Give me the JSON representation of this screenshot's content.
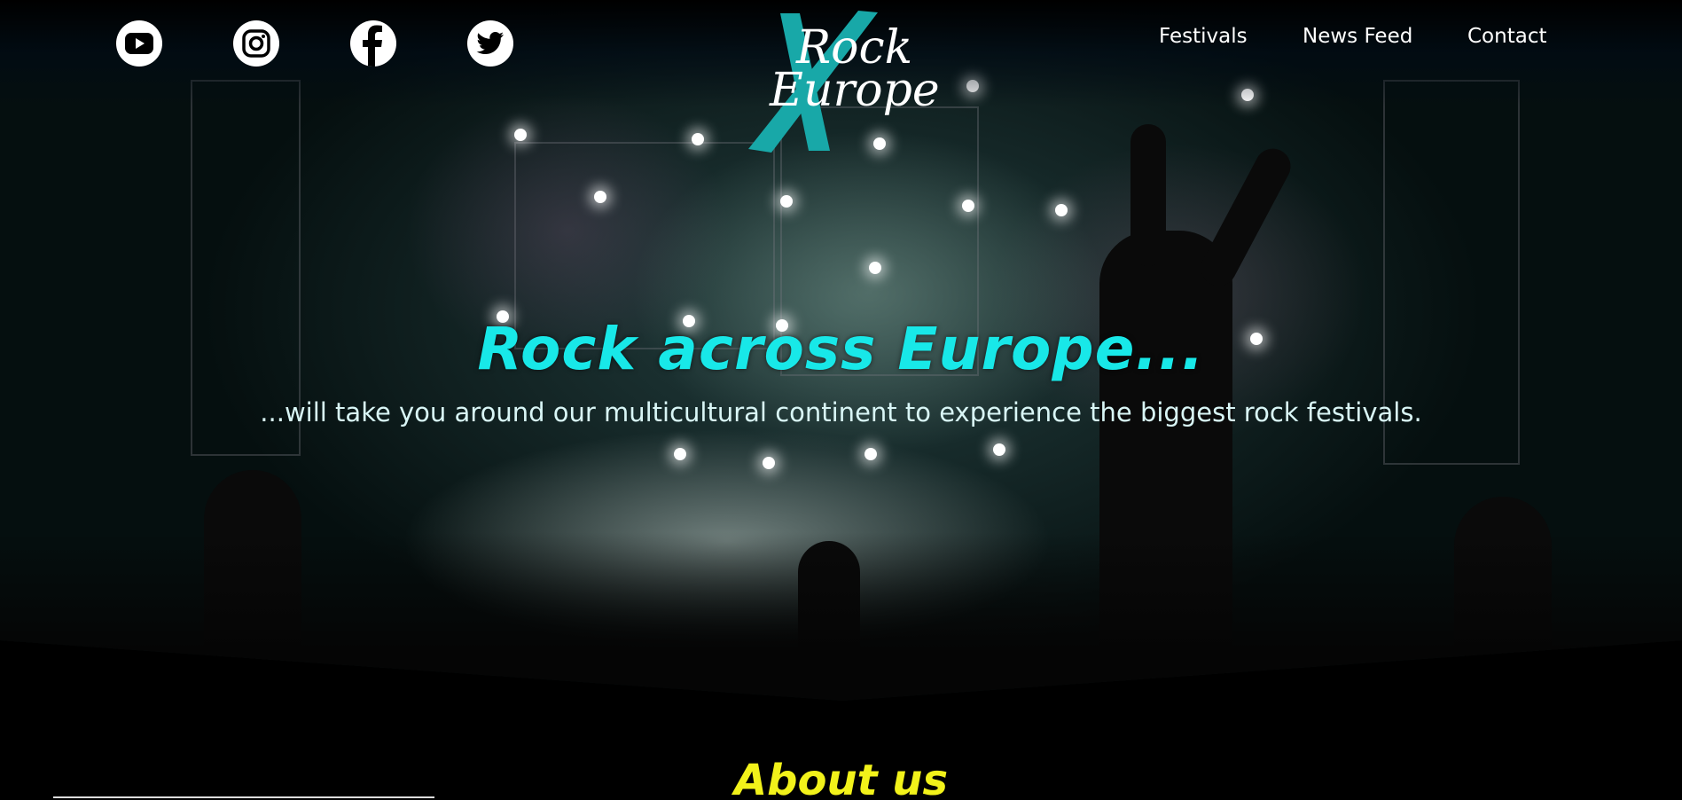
{
  "header": {
    "social": [
      {
        "name": "youtube-icon"
      },
      {
        "name": "instagram-icon"
      },
      {
        "name": "facebook-icon"
      },
      {
        "name": "twitter-icon"
      }
    ],
    "logo": {
      "line1": "Rock",
      "line2": "Europe"
    },
    "nav": [
      "Festivals",
      "News Feed",
      "Contact"
    ]
  },
  "hero": {
    "title": "Rock across Europe...",
    "subtitle": "...will take you around our multicultural continent to experience the biggest rock festivals."
  },
  "about": {
    "title": "About us"
  },
  "colors": {
    "accent_cyan": "#18e8e8",
    "logo_teal": "#18a8a8",
    "about_yellow": "#f2f21a"
  }
}
